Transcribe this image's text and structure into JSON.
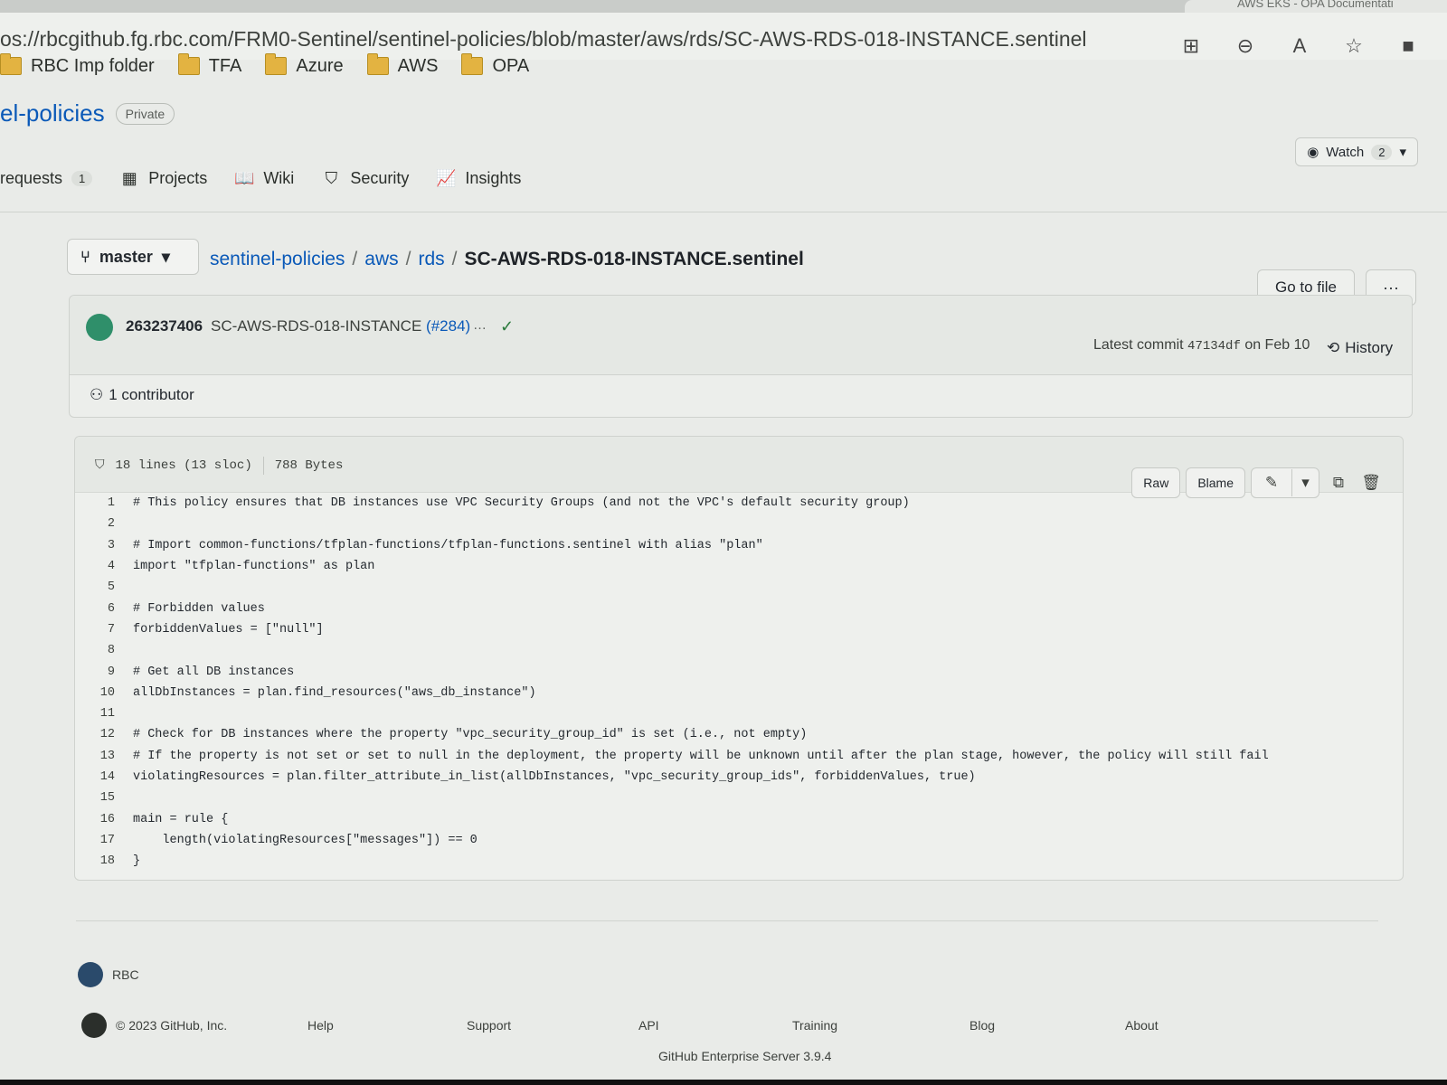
{
  "browser": {
    "url": "os://rbcgithub.fg.rbc.com/FRM0-Sentinel/sentinel-policies/blob/master/aws/rds/SC-AWS-RDS-018-INSTANCE.sentinel",
    "other_tab_title": "AWS EKS - OPA Documentati"
  },
  "bookmarks": [
    {
      "label": "RBC Imp folder"
    },
    {
      "label": "TFA"
    },
    {
      "label": "Azure"
    },
    {
      "label": "AWS"
    },
    {
      "label": "OPA"
    }
  ],
  "repo": {
    "name": "el-policies",
    "visibility": "Private",
    "watch_label": "Watch",
    "watch_count": "2"
  },
  "nav": {
    "pull_requests_label": "requests",
    "pull_requests_count": "1",
    "projects": "Projects",
    "wiki": "Wiki",
    "security": "Security",
    "insights": "Insights"
  },
  "file_nav": {
    "branch": "master",
    "crumbs": [
      "sentinel-policies",
      "aws",
      "rds"
    ],
    "separator": "/",
    "file": "SC-AWS-RDS-018-INSTANCE.sentinel",
    "go_to_file": "Go to file",
    "more": "···"
  },
  "commit": {
    "author": "263237406",
    "message": "SC-AWS-RDS-018-INSTANCE",
    "pr": "(#284)",
    "ellipsis": "…",
    "latest_prefix": "Latest commit",
    "hash": "47134df",
    "date": "on Feb 10",
    "history": "History",
    "contributors": "1 contributor"
  },
  "file": {
    "lines_info": "18 lines (13 sloc)",
    "size": "788 Bytes",
    "raw": "Raw",
    "blame": "Blame"
  },
  "code_lines": [
    {
      "n": "1",
      "text": "# This policy ensures that DB instances use VPC Security Groups (and not the VPC's default security group)"
    },
    {
      "n": "2",
      "text": ""
    },
    {
      "n": "3",
      "text": "# Import common-functions/tfplan-functions/tfplan-functions.sentinel with alias \"plan\""
    },
    {
      "n": "4",
      "text": "import \"tfplan-functions\" as plan"
    },
    {
      "n": "5",
      "text": ""
    },
    {
      "n": "6",
      "text": "# Forbidden values"
    },
    {
      "n": "7",
      "text": "forbiddenValues = [\"null\"]"
    },
    {
      "n": "8",
      "text": ""
    },
    {
      "n": "9",
      "text": "# Get all DB instances"
    },
    {
      "n": "10",
      "text": "allDbInstances = plan.find_resources(\"aws_db_instance\")"
    },
    {
      "n": "11",
      "text": ""
    },
    {
      "n": "12",
      "text": "# Check for DB instances where the property \"vpc_security_group_id\" is set (i.e., not empty)"
    },
    {
      "n": "13",
      "text": "# If the property is not set or set to null in the deployment, the property will be unknown until after the plan stage, however, the policy will still fail"
    },
    {
      "n": "14",
      "text": "violatingResources = plan.filter_attribute_in_list(allDbInstances, \"vpc_security_group_ids\", forbiddenValues, true)"
    },
    {
      "n": "15",
      "text": ""
    },
    {
      "n": "16",
      "text": "main = rule {"
    },
    {
      "n": "17",
      "text": "    length(violatingResources[\"messages\"]) == 0"
    },
    {
      "n": "18",
      "text": "}"
    }
  ],
  "footer": {
    "org": "RBC",
    "copyright": "© 2023 GitHub, Inc.",
    "links": [
      "Help",
      "Support",
      "API",
      "Training",
      "Blog",
      "About"
    ],
    "enterprise": "GitHub Enterprise Server 3.9.4"
  }
}
